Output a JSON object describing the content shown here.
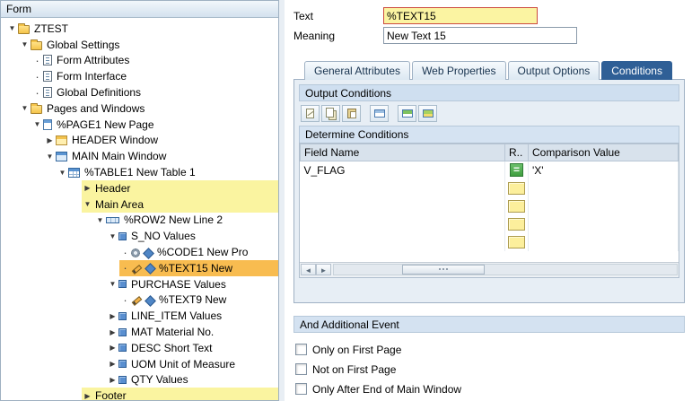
{
  "left_panel": {
    "title": "Form",
    "tree": [
      {
        "label": "ZTEST",
        "level": 0,
        "exp": "open",
        "icons": [
          "folder"
        ]
      },
      {
        "label": "Global Settings",
        "level": 1,
        "exp": "open",
        "icons": [
          "folder"
        ]
      },
      {
        "label": "Form Attributes",
        "level": 2,
        "exp": "leaf",
        "icons": [
          "doc"
        ]
      },
      {
        "label": "Form Interface",
        "level": 2,
        "exp": "leaf",
        "icons": [
          "doc"
        ]
      },
      {
        "label": "Global Definitions",
        "level": 2,
        "exp": "leaf",
        "icons": [
          "doc"
        ]
      },
      {
        "label": "Pages and Windows",
        "level": 1,
        "exp": "open",
        "icons": [
          "folder"
        ]
      },
      {
        "label": "%PAGE1 New Page",
        "level": 2,
        "exp": "open",
        "icons": [
          "page"
        ]
      },
      {
        "label": "HEADER Window",
        "level": 3,
        "exp": "closed",
        "icons": [
          "window-yellow"
        ]
      },
      {
        "label": "MAIN Main Window",
        "level": 3,
        "exp": "open",
        "icons": [
          "window-blue"
        ]
      },
      {
        "label": "%TABLE1 New Table 1",
        "level": 4,
        "exp": "open",
        "icons": [
          "table"
        ]
      },
      {
        "label": "Header",
        "level": 6,
        "exp": "closed",
        "icons": [],
        "hl": "band"
      },
      {
        "label": "Main Area",
        "level": 6,
        "exp": "open",
        "icons": [],
        "hl": "band"
      },
      {
        "label": "%ROW2 New Line 2",
        "level": 7,
        "exp": "open",
        "icons": [
          "row"
        ]
      },
      {
        "label": "S_NO Values",
        "level": 8,
        "exp": "open",
        "icons": [
          "cell"
        ]
      },
      {
        "label": "%CODE1 New Pro",
        "level": 9,
        "exp": "leaf",
        "icons": [
          "gear",
          "diamond"
        ]
      },
      {
        "label": "%TEXT15 New",
        "level": 9,
        "exp": "leaf",
        "icons": [
          "pencil",
          "diamond"
        ],
        "hl": "selected"
      },
      {
        "label": "PURCHASE Values",
        "level": 8,
        "exp": "open",
        "icons": [
          "cell"
        ]
      },
      {
        "label": "%TEXT9 New",
        "level": 9,
        "exp": "leaf",
        "icons": [
          "pencil",
          "diamond"
        ]
      },
      {
        "label": "LINE_ITEM Values",
        "level": 8,
        "exp": "closed",
        "icons": [
          "cell"
        ]
      },
      {
        "label": "MAT Material No.",
        "level": 8,
        "exp": "closed",
        "icons": [
          "cell"
        ]
      },
      {
        "label": "DESC Short Text",
        "level": 8,
        "exp": "closed",
        "icons": [
          "cell"
        ]
      },
      {
        "label": "UOM Unit of Measure",
        "level": 8,
        "exp": "closed",
        "icons": [
          "cell"
        ]
      },
      {
        "label": "QTY Values",
        "level": 8,
        "exp": "closed",
        "icons": [
          "cell"
        ]
      },
      {
        "label": "Footer",
        "level": 6,
        "exp": "closed",
        "icons": [],
        "hl": "band"
      }
    ]
  },
  "right_panel": {
    "fields": {
      "text_label": "Text",
      "text_value": "%TEXT15",
      "meaning_label": "Meaning",
      "meaning_value": "New Text 15"
    },
    "tabs": [
      {
        "label": "General Attributes",
        "active": false
      },
      {
        "label": "Web Properties",
        "active": false
      },
      {
        "label": "Output Options",
        "active": false
      },
      {
        "label": "Conditions",
        "active": true
      }
    ],
    "output_conditions": {
      "title": "Output Conditions",
      "toolbar": [
        "cut",
        "copy",
        "paste",
        "select",
        "insert-line",
        "append-line"
      ],
      "subtitle": "Determine Conditions",
      "columns": [
        "Field Name",
        "R..",
        "Comparison Value"
      ],
      "rows": [
        {
          "field": "V_FLAG",
          "op": "=",
          "value": "'X'"
        },
        {
          "field": "",
          "op": "",
          "value": ""
        },
        {
          "field": "",
          "op": "",
          "value": ""
        },
        {
          "field": "",
          "op": "",
          "value": ""
        },
        {
          "field": "",
          "op": "",
          "value": ""
        }
      ]
    },
    "additional_event": {
      "title": "And Additional Event",
      "checkboxes": [
        {
          "label": "Only on First Page",
          "checked": false
        },
        {
          "label": "Not on First Page",
          "checked": false
        },
        {
          "label": "Only After End of Main Window",
          "checked": false
        }
      ]
    }
  }
}
